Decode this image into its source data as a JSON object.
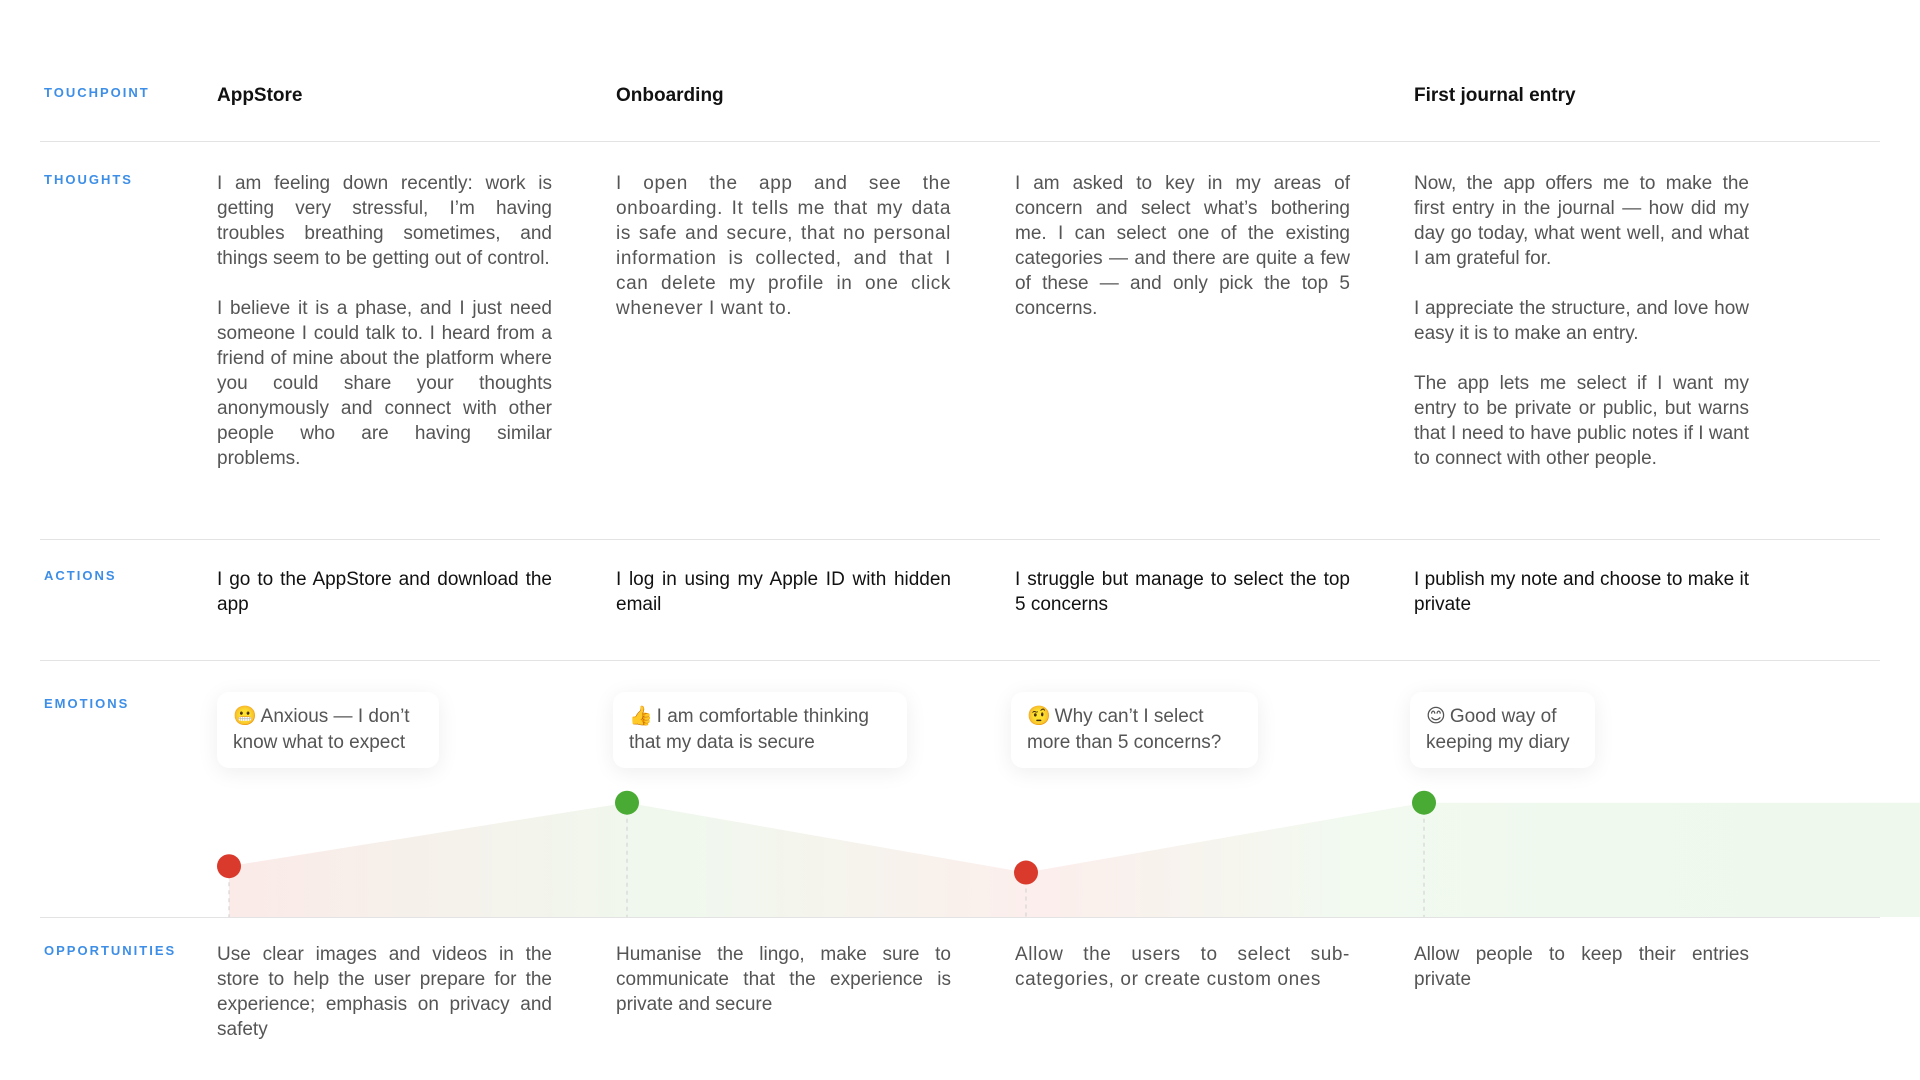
{
  "row_labels": {
    "touchpoint": "TOUCHPOINT",
    "thoughts": "THOUGHTS",
    "actions": "ACTIONS",
    "emotions": "EMOTIONS",
    "opportunities": "OPPORTUNITIES"
  },
  "touchpoints": [
    "AppStore",
    "Onboarding",
    "First journal entry"
  ],
  "thoughts": [
    [
      "I am feeling down recently: work is getting very stressful, I’m having troubles breathing sometimes, and things seem to be getting out of control.",
      "I believe it is a phase, and I just need someone I could talk to. I heard from a friend of mine about the platform where you could share your thoughts anonymously and connect with other people who are having similar problems."
    ],
    [
      "I open the app and see the onboarding. It tells me that my data is safe and secure, that no personal information is collected, and that I can delete my profile in one click whenever I want to."
    ],
    [
      "I am asked to key in my areas of concern and select what’s bothering me. I can select one of the existing categories — and there are quite a few of these — and only pick the top 5 concerns."
    ],
    [
      "Now, the app offers me to make the first entry in the journal — how did my day go today, what went well, and what I am grateful for.",
      "I appreciate the structure, and love how easy it is to make an entry.",
      "The app lets me select if I want my entry to be private or public, but warns that I need to have public notes if I want to connect with other people."
    ]
  ],
  "actions": [
    "I go to the AppStore and download the app",
    "I log in using my Apple ID with hidden email",
    "I struggle but manage to select the top 5 concerns",
    "I publish my note and choose to make it private"
  ],
  "emotions": [
    {
      "emoji": "😬",
      "text": "Anxious — I don’t know what to expect",
      "sentiment": "negative",
      "level": 0.4,
      "color": "#d93a2b"
    },
    {
      "emoji": "👍",
      "text": "I am comfortable thinking that my data is secure",
      "sentiment": "positive",
      "level": 0.9,
      "color": "#4aab34"
    },
    {
      "emoji": "🤨",
      "text": "Why can’t I select more than 5 concerns?",
      "sentiment": "negative",
      "level": 0.35,
      "color": "#d93a2b"
    },
    {
      "emoji": "😊",
      "text": "Good way of keeping my diary",
      "sentiment": "positive",
      "level": 0.9,
      "color": "#4aab34"
    }
  ],
  "opportunities": [
    "Use clear images and videos in the store to help the user prepare for the experience; emphasis on privacy and safety",
    "Humanise the lingo, make sure to communicate that the experience is private and secure",
    "Allow the users to select sub-categories, or create custom ones",
    "Allow people to keep their entries private"
  ],
  "colors": {
    "label_blue": "#3d8ee6",
    "negative": "#d93a2b",
    "positive": "#4aab34"
  }
}
